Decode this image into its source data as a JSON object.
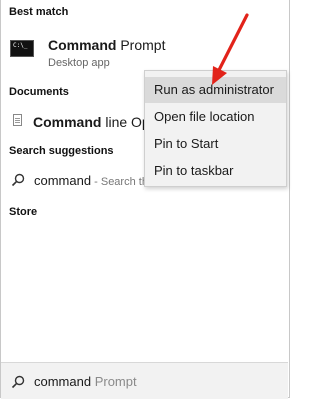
{
  "best_match": {
    "heading": "Best match",
    "app_name_bold": "Command",
    "app_name_rest": " Prompt",
    "app_subtitle": "Desktop app",
    "icon": "cmd-icon",
    "icon_glyph": "C:\\_"
  },
  "documents": {
    "heading": "Documents",
    "item_bold": "Command",
    "item_rest": " line Opt",
    "icon": "document-icon"
  },
  "search_suggestions": {
    "heading": "Search suggestions",
    "item": "command",
    "item_suffix": " - Search th",
    "icon": "search-icon"
  },
  "store": {
    "heading": "Store"
  },
  "context_menu": {
    "items": [
      {
        "label": "Run as administrator",
        "hover": true
      },
      {
        "label": "Open file location",
        "hover": false
      },
      {
        "label": "Pin to Start",
        "hover": false
      },
      {
        "label": "Pin to taskbar",
        "hover": false
      }
    ]
  },
  "annotation": {
    "arrow_color": "#e2231a"
  },
  "search_box": {
    "typed": "command",
    "suggested_completion": " Prompt",
    "icon": "search-icon"
  }
}
